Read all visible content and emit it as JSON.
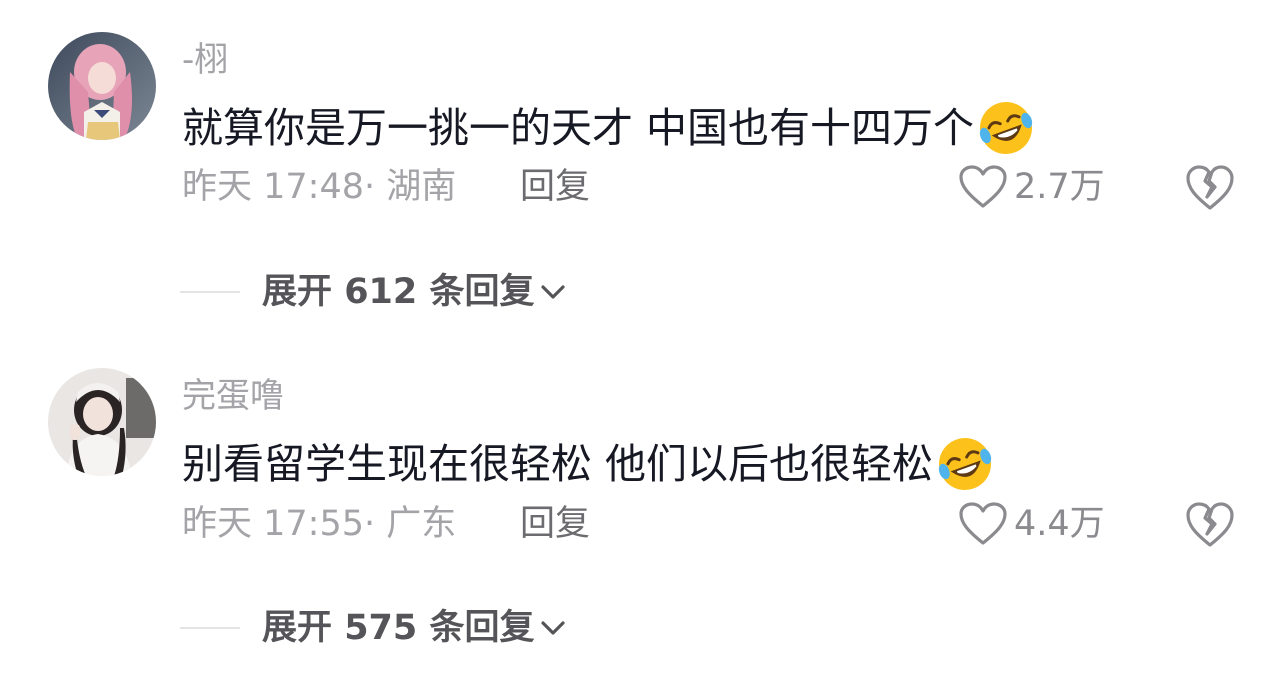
{
  "comments": [
    {
      "username": "-栩",
      "text": "就算你是万一挑一的天才 中国也有十四万个",
      "emoji": "rolling-on-floor-laughing",
      "time": "昨天 17:48",
      "sep": "·",
      "region": "湖南",
      "reply_label": "回复",
      "likes": "2.7万",
      "expand_prefix": "展开",
      "expand_count": "612",
      "expand_suffix": "条回复"
    },
    {
      "username": "完蛋噜",
      "text": "别看留学生现在很轻松 他们以后也很轻松",
      "emoji": "rolling-on-floor-laughing",
      "time": "昨天 17:55",
      "sep": "·",
      "region": "广东",
      "reply_label": "回复",
      "likes": "4.4万",
      "expand_prefix": "展开",
      "expand_count": "575",
      "expand_suffix": "条回复"
    }
  ],
  "colors": {
    "primary_text": "#161823",
    "secondary_text": "#a4a4a8",
    "reply_text": "#6b6b70",
    "expand_text": "#555559",
    "divider": "#e4e4e6"
  }
}
